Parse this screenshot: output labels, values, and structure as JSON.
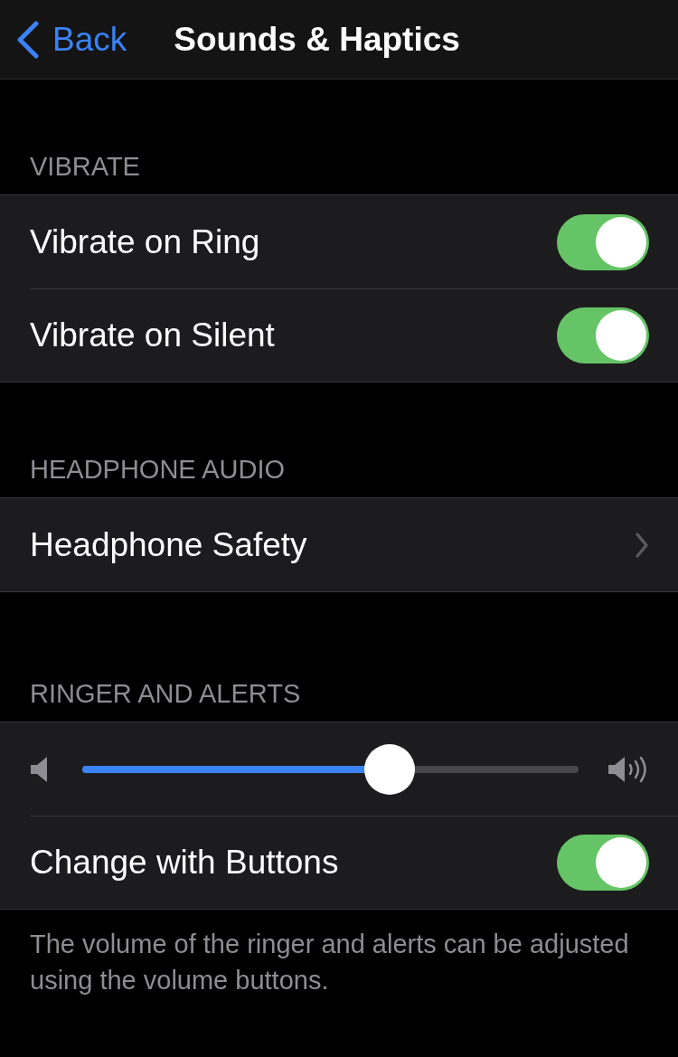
{
  "nav": {
    "back": "Back",
    "title": "Sounds & Haptics"
  },
  "sections": [
    {
      "header": "VIBRATE",
      "rows": [
        {
          "kind": "toggle",
          "label": "Vibrate on Ring",
          "on": true
        },
        {
          "kind": "toggle",
          "label": "Vibrate on Silent",
          "on": true
        }
      ]
    },
    {
      "header": "HEADPHONE AUDIO",
      "rows": [
        {
          "kind": "link",
          "label": "Headphone Safety"
        }
      ]
    },
    {
      "header": "RINGER AND ALERTS",
      "rows": [
        {
          "kind": "slider",
          "level": 0.62
        },
        {
          "kind": "toggle",
          "label": "Change with Buttons",
          "on": true
        }
      ],
      "footer": "The volume of the ringer and alerts can be adjusted using the volume buttons."
    }
  ]
}
